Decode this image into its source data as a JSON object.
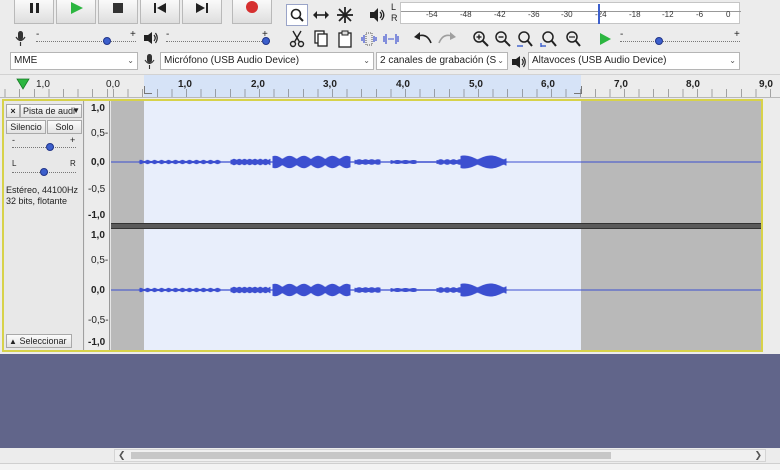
{
  "meter": {
    "lr_top": "L",
    "lr_bottom": "R",
    "scale": [
      "-54",
      "-48",
      "-42",
      "-36",
      "-30",
      "-24",
      "-18",
      "-12",
      "-6",
      "0"
    ]
  },
  "mixer": {
    "minus": "-",
    "plus": "+"
  },
  "devices": {
    "host": "MME",
    "recording_device": "Micrófono (USB Audio Device)",
    "channels": "2 canales de grabación (S",
    "playback_device": "Altavoces (USB Audio Device)"
  },
  "ruler": {
    "labels": [
      "1,0",
      "0,0",
      "1,0",
      "2,0",
      "3,0",
      "4,0",
      "5,0",
      "6,0",
      "7,0",
      "8,0",
      "9,0"
    ]
  },
  "track": {
    "name": "Pista de audi",
    "mute_label": "Silencio",
    "solo_label": "Solo",
    "gain_minus": "-",
    "gain_plus": "+",
    "pan_left": "L",
    "pan_right": "R",
    "info_line1": "Estéreo, 44100Hz",
    "info_line2": "32 bits, flotante",
    "select_label": "Seleccionar",
    "amp_labels": [
      "1,0",
      "0,5-",
      "0,0",
      "-0,5",
      "-1,0"
    ],
    "amp_labels_ch2": [
      "1,0",
      "0,5-",
      "0,0",
      "-0,5-",
      "-1,0"
    ]
  },
  "colors": {
    "waveform": "#3c4fd0",
    "selection_bg": "#e8eefb",
    "unselected_bg": "#b9b9b9",
    "empty_area": "#61658a",
    "track_border": "#d7d24a",
    "play_green": "#2cb640",
    "record_red": "#d63030"
  }
}
